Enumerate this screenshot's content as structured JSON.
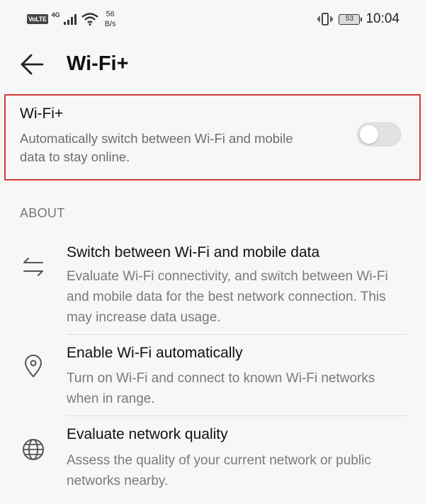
{
  "status_bar": {
    "volte": "VoLTE",
    "network": "4G",
    "speed_value": "56",
    "speed_unit": "B/s",
    "battery": "53",
    "time": "10:04"
  },
  "header": {
    "title": "Wi-Fi+",
    "back_icon": "arrow-left-icon"
  },
  "wifi_plus": {
    "title": "Wi-Fi+",
    "description": "Automatically switch between Wi-Fi and mobile data to stay online.",
    "enabled": false,
    "highlight_color": "#d23a3a"
  },
  "about": {
    "header": "ABOUT",
    "items": [
      {
        "icon": "swap-arrows-icon",
        "title": "Switch between Wi-Fi and mobile data",
        "description": "Evaluate Wi-Fi connectivity, and switch between Wi-Fi and mobile data for the best network connection. This may increase data usage."
      },
      {
        "icon": "location-pin-icon",
        "title": "Enable Wi-Fi automatically",
        "description": "Turn on Wi-Fi and connect to known Wi-Fi networks when in range."
      },
      {
        "icon": "globe-icon",
        "title": "Evaluate network quality",
        "description": "Assess the quality of your current network or public networks nearby."
      }
    ]
  }
}
